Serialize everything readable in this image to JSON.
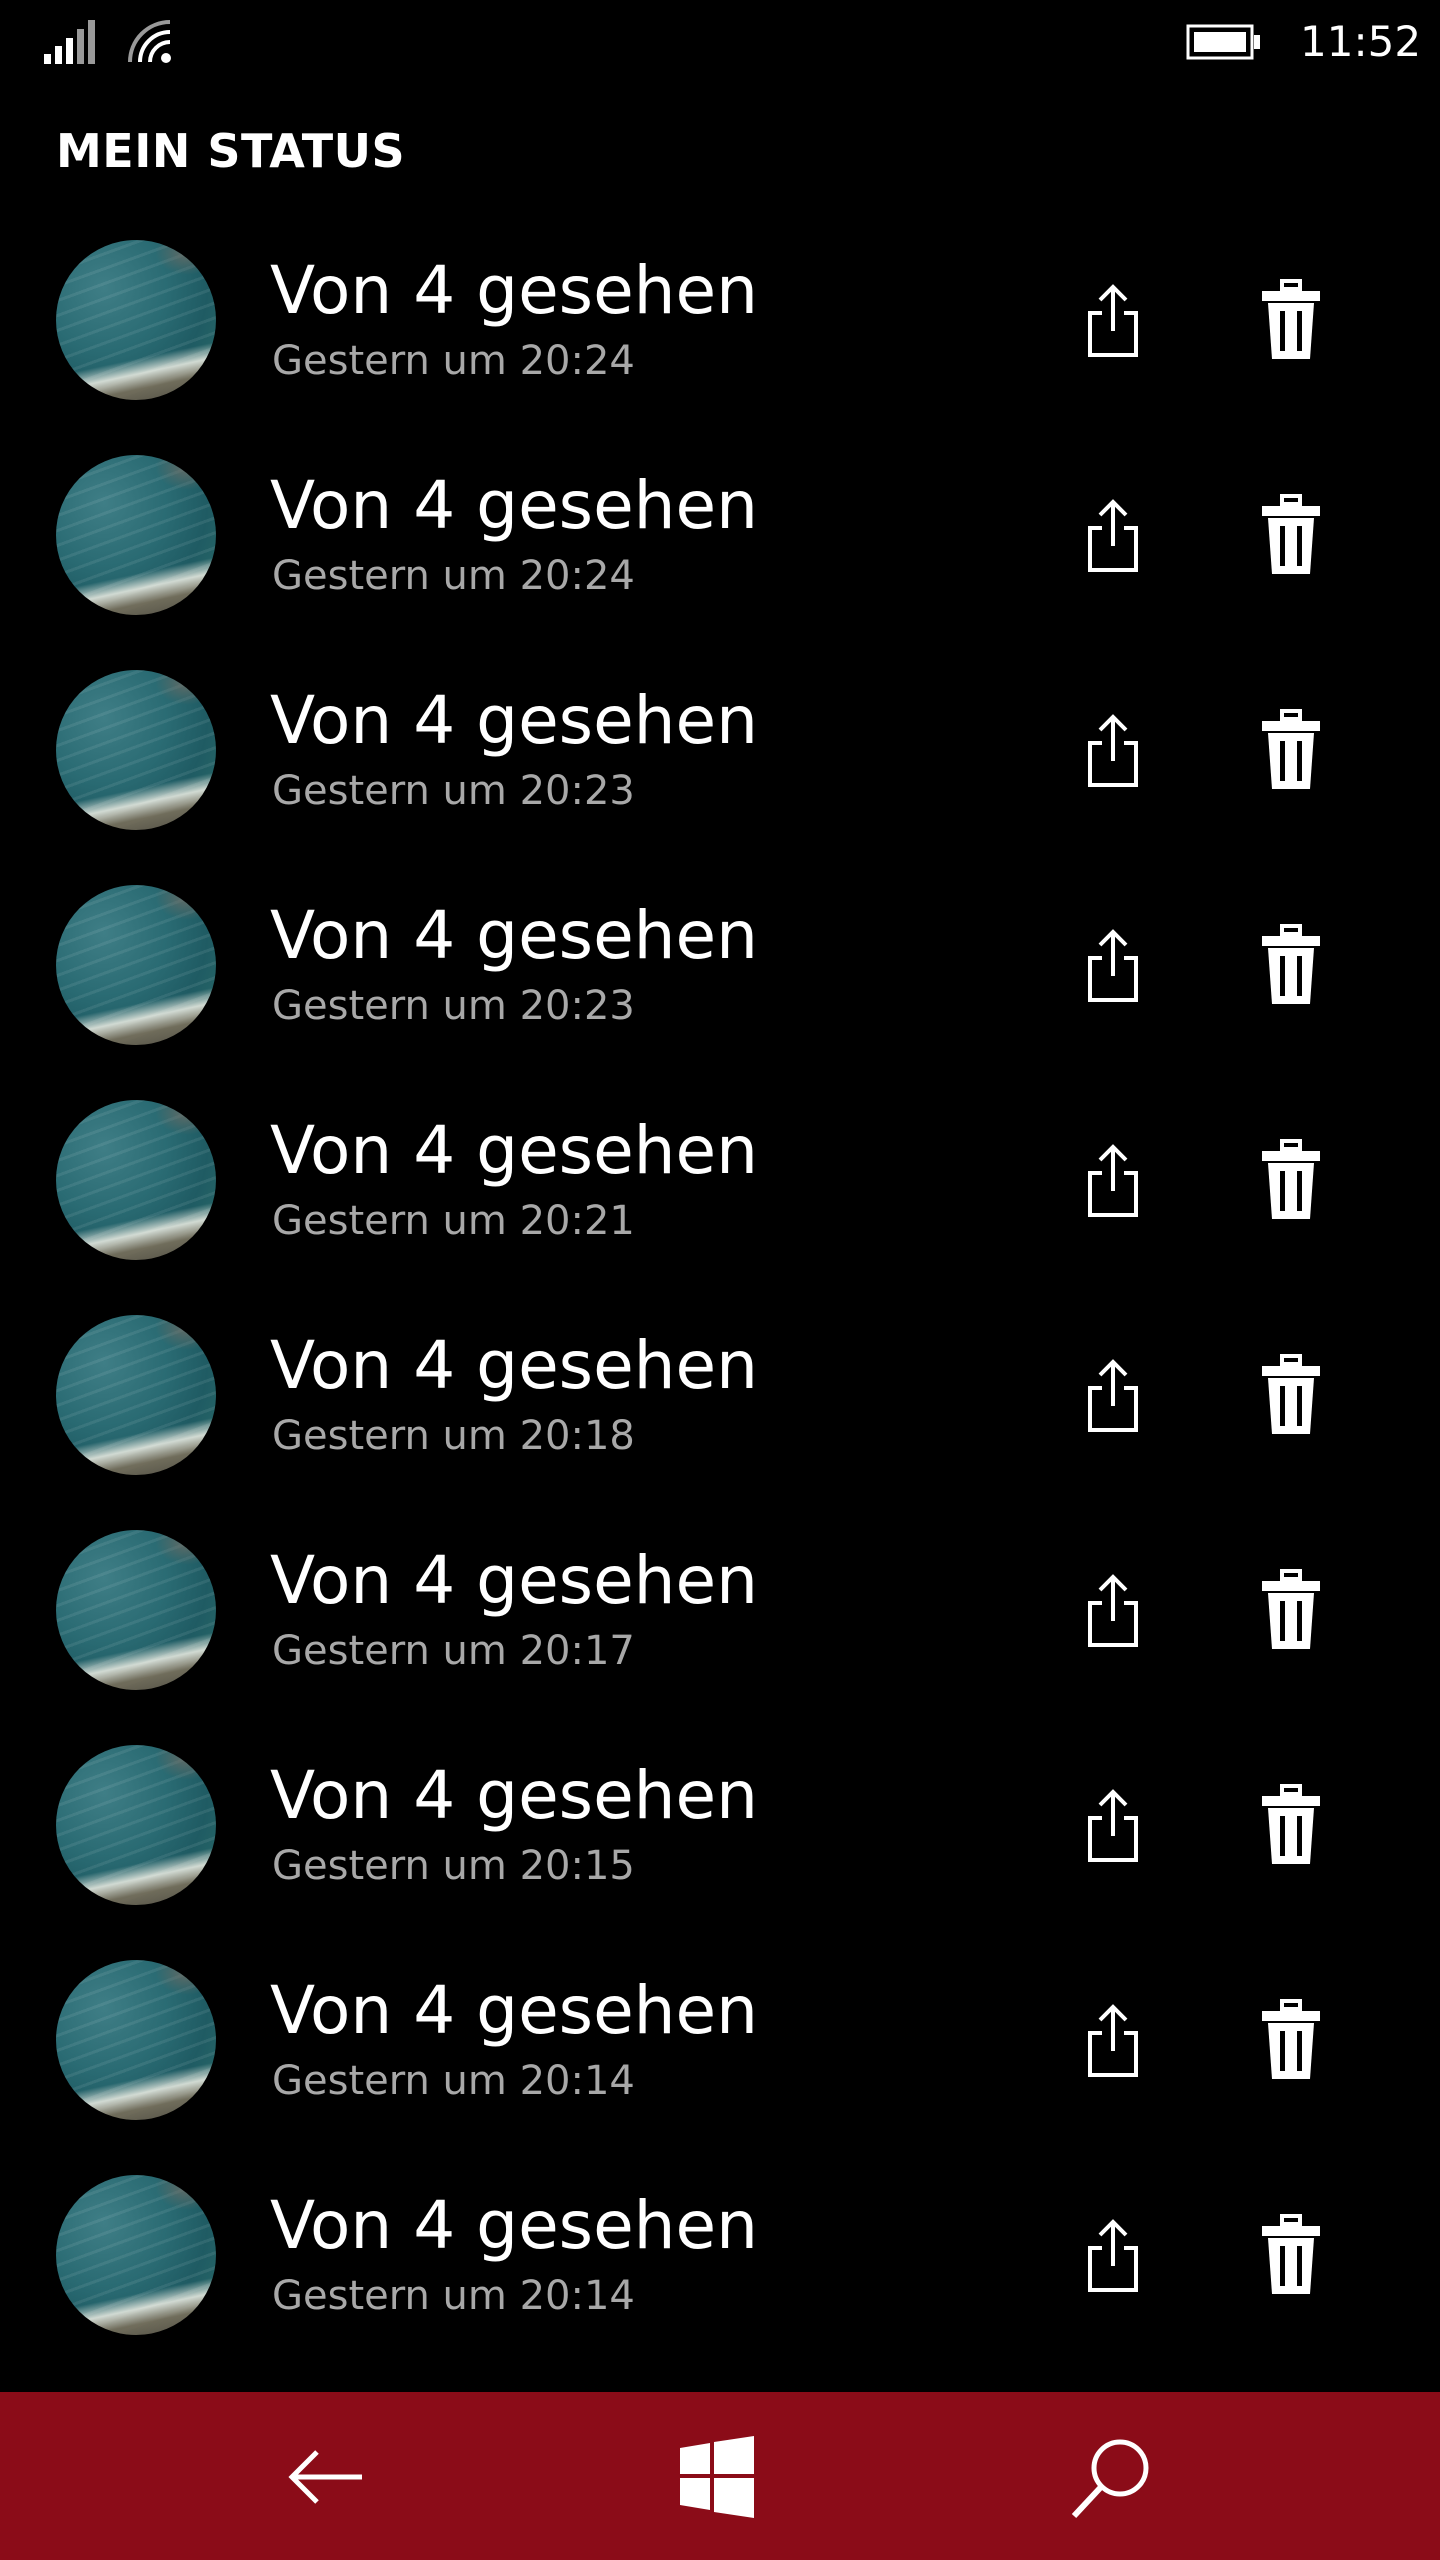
{
  "status_bar": {
    "time": "11:52",
    "icons": [
      "signal-icon",
      "wifi-icon",
      "battery-icon"
    ]
  },
  "section": {
    "title": "MEIN STATUS"
  },
  "status_items": [
    {
      "title": "Von 4 gesehen",
      "subtitle": "Gestern um 20:24"
    },
    {
      "title": "Von 4 gesehen",
      "subtitle": "Gestern um 20:24"
    },
    {
      "title": "Von 4 gesehen",
      "subtitle": "Gestern um 20:23"
    },
    {
      "title": "Von 4 gesehen",
      "subtitle": "Gestern um 20:23"
    },
    {
      "title": "Von 4 gesehen",
      "subtitle": "Gestern um 20:21"
    },
    {
      "title": "Von 4 gesehen",
      "subtitle": "Gestern um 20:18"
    },
    {
      "title": "Von 4 gesehen",
      "subtitle": "Gestern um 20:17"
    },
    {
      "title": "Von 4 gesehen",
      "subtitle": "Gestern um 20:15"
    },
    {
      "title": "Von 4 gesehen",
      "subtitle": "Gestern um 20:14"
    },
    {
      "title": "Von 4 gesehen",
      "subtitle": "Gestern um 20:14"
    }
  ],
  "row_icons": {
    "share": "share-icon",
    "delete": "trash-icon"
  },
  "nav_bar": {
    "background": "#8b0c18",
    "buttons": [
      "back-arrow-icon",
      "windows-logo-icon",
      "search-icon"
    ]
  },
  "colors": {
    "background": "#000000",
    "text": "#ffffff",
    "secondary_text": "#a8a8a8"
  }
}
